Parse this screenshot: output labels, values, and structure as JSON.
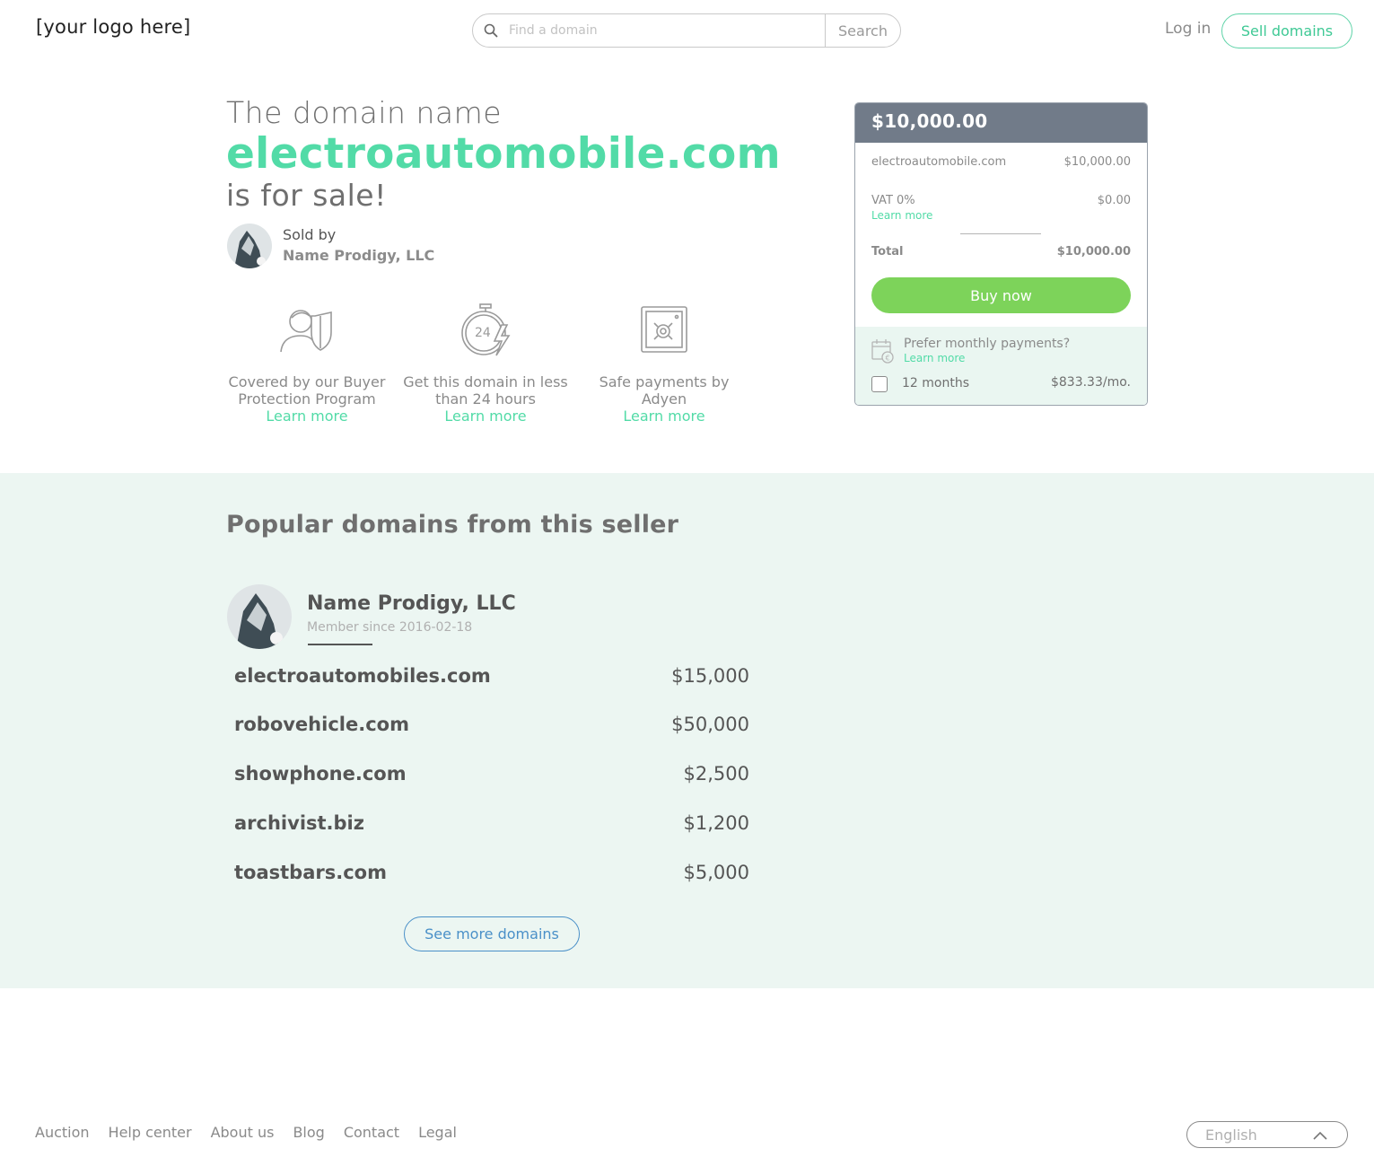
{
  "header": {
    "logo": "[your logo here]",
    "search_placeholder": "Find a domain",
    "search_button": "Search",
    "login": "Log in",
    "sell": "Sell domains"
  },
  "hero": {
    "line1": "The domain name",
    "domain": "electroautomobile.com",
    "line3": "is for sale!",
    "sold_by": "Sold by",
    "seller": "Name Prodigy, LLC"
  },
  "features": [
    {
      "icon": "buyer-protection-icon",
      "text": "Covered by our Buyer Protection Program",
      "link": "Learn more"
    },
    {
      "icon": "24-hours-icon",
      "text": "Get this domain in less than 24 hours",
      "link": "Learn more"
    },
    {
      "icon": "safe-icon",
      "text": "Safe payments by Adyen",
      "link": "Learn more"
    }
  ],
  "card": {
    "price": "$10,000.00",
    "item_label": "electroautomobile.com",
    "item_price": "$10,000.00",
    "vat_label": "VAT 0%",
    "vat_price": "$0.00",
    "vat_link": "Learn more",
    "total_label": "Total",
    "total_price": "$10,000.00",
    "buy": "Buy now",
    "monthly_q": "Prefer monthly payments?",
    "monthly_link": "Learn more",
    "months": "12 months",
    "per_month": "$833.33/mo."
  },
  "popular": {
    "title": "Popular domains from this seller",
    "seller": "Name Prodigy, LLC",
    "member_since": "Member since 2016-02-18",
    "domains": [
      {
        "name": "electroautomobiles.com",
        "price": "$15,000"
      },
      {
        "name": "robovehicle.com",
        "price": "$50,000"
      },
      {
        "name": "showphone.com",
        "price": "$2,500"
      },
      {
        "name": "archivist.biz",
        "price": "$1,200"
      },
      {
        "name": "toastbars.com",
        "price": "$5,000"
      }
    ],
    "see_more": "See more domains"
  },
  "footer": {
    "links": [
      "Auction",
      "Help center",
      "About us",
      "Blog",
      "Contact",
      "Legal"
    ],
    "language": "English"
  },
  "colors": {
    "accent": "#52dba7",
    "buy": "#7dd35a",
    "card_header": "#717b89",
    "section_bg": "#ecf6f2"
  }
}
